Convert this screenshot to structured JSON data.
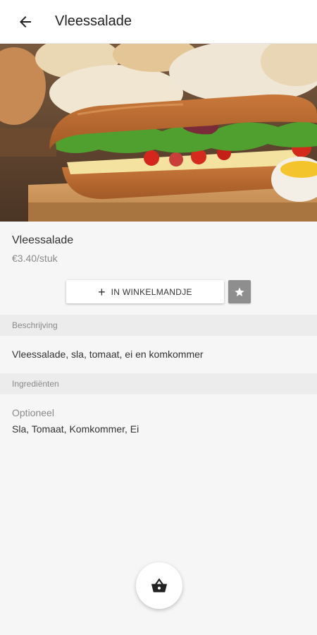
{
  "appbar": {
    "title": "Vleessalade"
  },
  "product": {
    "name": "Vleessalade",
    "price": "€3.40/stuk"
  },
  "actions": {
    "add_to_cart_label": "IN WINKELMANDJE",
    "add_icon": "plus-icon",
    "favorite_icon": "star-icon"
  },
  "sections": {
    "description_header": "Beschrijving",
    "description_text": "Vleessalade, sla, tomaat, ei en komkommer",
    "ingredients_header": "Ingrediënten",
    "optional_label": "Optioneel",
    "optional_items": "Sla, Tomaat, Komkommer, Ei"
  },
  "icons": {
    "back": "arrow-left-icon",
    "basket": "basket-icon",
    "hero": "sandwich-photo"
  },
  "colors": {
    "background": "#f6f6f6",
    "section_header": "#ececec",
    "favorite_button": "#8e8e8e"
  }
}
